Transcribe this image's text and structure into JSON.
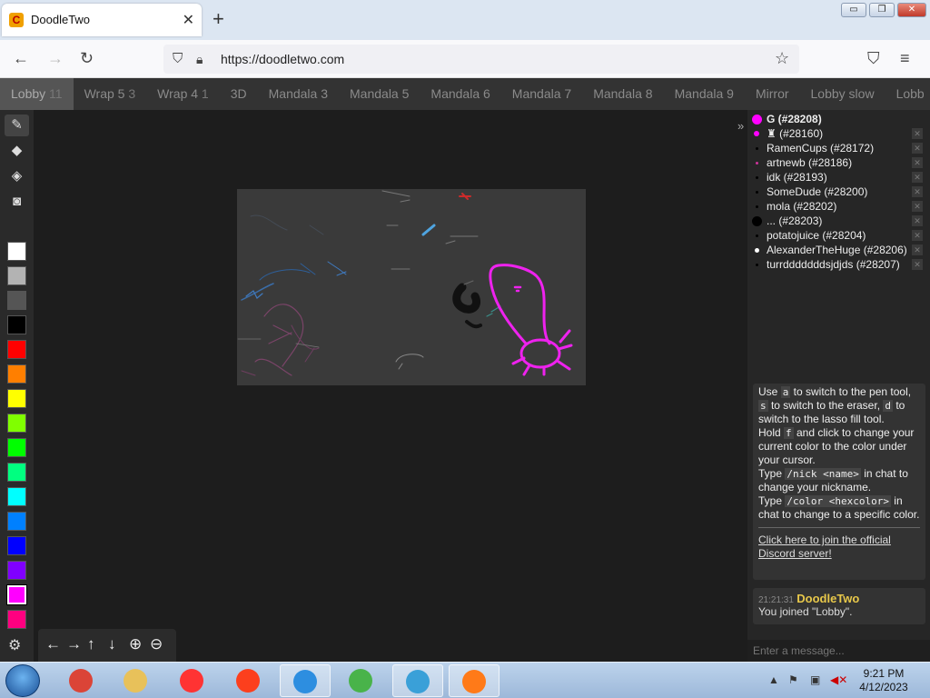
{
  "browser": {
    "tab_title": "DoodleTwo",
    "tab_favicon": "C",
    "url": "https://doodletwo.com",
    "window_buttons": {
      "minimize": "▭",
      "restore": "❐",
      "close": "✕"
    }
  },
  "rooms": [
    {
      "label": "Lobby",
      "count": "11",
      "active": true
    },
    {
      "label": "Wrap 5",
      "count": "3",
      "active": false
    },
    {
      "label": "Wrap 4",
      "count": "1",
      "active": false
    },
    {
      "label": "3D",
      "count": "",
      "active": false
    },
    {
      "label": "Mandala 3",
      "count": "",
      "active": false
    },
    {
      "label": "Mandala 5",
      "count": "",
      "active": false
    },
    {
      "label": "Mandala 6",
      "count": "",
      "active": false
    },
    {
      "label": "Mandala 7",
      "count": "",
      "active": false
    },
    {
      "label": "Mandala 8",
      "count": "",
      "active": false
    },
    {
      "label": "Mandala 9",
      "count": "",
      "active": false
    },
    {
      "label": "Mirror",
      "count": "",
      "active": false
    },
    {
      "label": "Lobby slow",
      "count": "",
      "active": false
    },
    {
      "label": "Lobb",
      "count": "",
      "active": false
    }
  ],
  "tools": [
    {
      "name": "pen-tool-icon",
      "glyph": "✎",
      "active": true
    },
    {
      "name": "eraser-tool-icon",
      "glyph": "◆",
      "active": false
    },
    {
      "name": "fill-tool-icon",
      "glyph": "◈",
      "active": false
    },
    {
      "name": "camera-icon",
      "glyph": "◙",
      "active": false
    }
  ],
  "palette": [
    "#ffffff",
    "#b3b3b3",
    "#555555",
    "#000000",
    "#ff0000",
    "#ff7f00",
    "#ffff00",
    "#80ff00",
    "#00ff00",
    "#00ff80",
    "#00ffff",
    "#0080ff",
    "#0000ff",
    "#8000ff",
    "#ff00ff",
    "#ff0080"
  ],
  "selected_color": "#ff00ff",
  "nav_arrows": [
    "←",
    "→",
    "↑",
    "↓",
    "⊕",
    "⊖"
  ],
  "users": [
    {
      "name": "G (#28208)",
      "color": "#ff00ff",
      "bold": true,
      "dot": 11,
      "closable": false
    },
    {
      "name": "♜ (#28160)",
      "color": "#ff00ff",
      "bold": false,
      "dot": 6,
      "closable": true
    },
    {
      "name": "RamenCups (#28172)",
      "color": "#000000",
      "bold": false,
      "dot": 3,
      "closable": true
    },
    {
      "name": "artnewb (#28186)",
      "color": "#cc3399",
      "bold": false,
      "dot": 3,
      "closable": true
    },
    {
      "name": "idk (#28193)",
      "color": "#000000",
      "bold": false,
      "dot": 3,
      "closable": true
    },
    {
      "name": "SomeDude (#28200)",
      "color": "#000000",
      "bold": false,
      "dot": 3,
      "closable": true
    },
    {
      "name": "mola (#28202)",
      "color": "#000000",
      "bold": false,
      "dot": 3,
      "closable": true
    },
    {
      "name": "... (#28203)",
      "color": "#000000",
      "bold": false,
      "dot": 11,
      "closable": true
    },
    {
      "name": "potatojuice (#28204)",
      "color": "#000000",
      "bold": false,
      "dot": 3,
      "closable": true
    },
    {
      "name": "AlexanderTheHuge (#28206)",
      "color": "#ffffff",
      "bold": false,
      "dot": 5,
      "closable": true
    },
    {
      "name": "turrdddddddsjdjds (#28207)",
      "color": "#000000",
      "bold": false,
      "dot": 3,
      "closable": true
    }
  ],
  "help": {
    "l1a": "Use",
    "k_a": "a",
    "l1b": "to switch to the pen tool,",
    "k_s": "s",
    "l2b": "to switch to the eraser,",
    "k_d": "d",
    "l2c": "to switch to the lasso fill tool.",
    "l3a": "Hold",
    "k_f": "f",
    "l3b": "and click to change your current color to the color under your cursor.",
    "l4a": "Type",
    "k_nick": "/nick <name>",
    "l4b": "in chat to change your nickname.",
    "l5a": "Type",
    "k_color": "/color <hexcolor>",
    "l5b": "in chat to change to a specific color.",
    "discord": "Click here to join the official Discord server!"
  },
  "chat": {
    "time": "21:21:31",
    "user": "DoodleTwo",
    "message": "You joined \"Lobby\".",
    "placeholder": "Enter a message..."
  },
  "taskbar": {
    "time": "9:21 PM",
    "date": "4/12/2023",
    "apps": [
      {
        "name": "chrome-icon",
        "color": "#db4437",
        "open": false
      },
      {
        "name": "file-explorer-icon",
        "color": "#e8c15a",
        "open": false
      },
      {
        "name": "yandex-browser-icon",
        "color": "#ff3333",
        "open": false
      },
      {
        "name": "yandex-icon",
        "color": "#fc3f1d",
        "open": false
      },
      {
        "name": "app-shield-icon",
        "color": "#2d8ee0",
        "open": true
      },
      {
        "name": "download-icon",
        "color": "#49b34a",
        "open": false
      },
      {
        "name": "task-manager-icon",
        "color": "#3aa0d8",
        "open": true
      },
      {
        "name": "firefox-icon",
        "color": "#ff7a18",
        "open": true
      }
    ]
  }
}
